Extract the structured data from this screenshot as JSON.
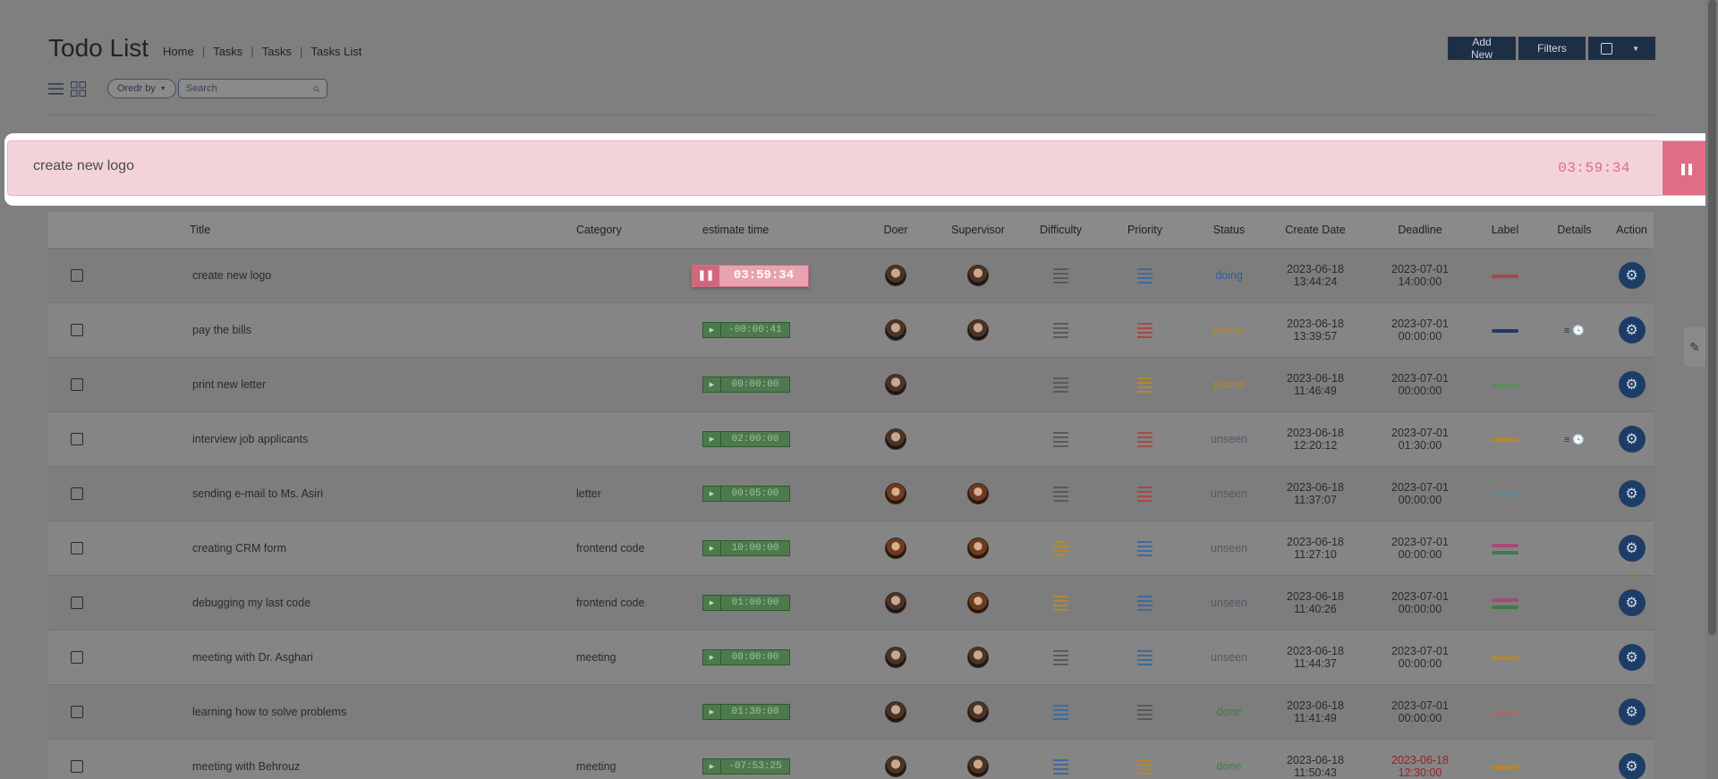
{
  "header": {
    "title": "Todo List",
    "breadcrumb": [
      "Home",
      "Tasks",
      "Tasks",
      "Tasks List"
    ],
    "add_new": "Add New",
    "filters": "Filters"
  },
  "toolbar": {
    "order_by": "Oredr by",
    "search_placeholder": "Search"
  },
  "active_timer": {
    "title": "create new logo",
    "time": "03:59:34"
  },
  "columns": [
    "Title",
    "Category",
    "estimate time",
    "Doer",
    "Supervisor",
    "Difficulty",
    "Priority",
    "Status",
    "Create Date",
    "Deadline",
    "Label",
    "Details",
    "Action"
  ],
  "colors": {
    "status_doing": "#2f5f9a",
    "status_pause": "#b8862a",
    "status_unseen": "#4f5966",
    "status_done": "#3f7a48",
    "deadline_overdue": "#9b1f1f",
    "lines_gray": "#5a5a5a",
    "lines_blue": "#3f6a9a",
    "lines_red": "#a84848",
    "lines_yellow": "#b08a30"
  },
  "rows": [
    {
      "title": "create new logo",
      "category": "",
      "est": "03:59:34",
      "active": true,
      "supervisor": true,
      "diff": "gray",
      "pri": "blue",
      "status": "doing",
      "status_color": "doing",
      "cdate": "2023-06-18",
      "ctime": "13:44:24",
      "ddate": "2023-07-01",
      "dtime": "14:00:00",
      "overdue": false,
      "labels": [
        "#a84848"
      ],
      "details": false
    },
    {
      "title": "pay the bills",
      "category": "",
      "est": "-00:00:41",
      "active": false,
      "supervisor": true,
      "diff": "gray",
      "pri": "red",
      "status": "pause",
      "status_color": "pause",
      "cdate": "2023-06-18",
      "ctime": "13:39:57",
      "ddate": "2023-07-01",
      "dtime": "00:00:00",
      "overdue": false,
      "labels": [
        "#1d3d66"
      ],
      "details": true
    },
    {
      "title": "print new letter",
      "category": "",
      "est": "00:00:00",
      "active": false,
      "supervisor": false,
      "diff": "gray",
      "pri": "yellow",
      "status": "pause",
      "status_color": "pause",
      "cdate": "2023-06-18",
      "ctime": "11:46:49",
      "ddate": "2023-07-01",
      "dtime": "00:00:00",
      "overdue": false,
      "labels": [
        "#5e8a5e"
      ],
      "details": false
    },
    {
      "title": "interview job applicants",
      "category": "",
      "est": "02:00:00",
      "active": false,
      "supervisor": false,
      "diff": "gray",
      "pri": "red",
      "status": "unseen",
      "status_color": "unseen",
      "cdate": "2023-06-18",
      "ctime": "12:20:12",
      "ddate": "2023-07-01",
      "dtime": "01:30:00",
      "overdue": false,
      "labels": [
        "#b8862a"
      ],
      "details": true
    },
    {
      "title": "sending e-mail to Ms. Asiri",
      "category": "letter",
      "est": "00:05:00",
      "active": false,
      "supervisor": true,
      "diff": "gray",
      "pri": "red",
      "status": "unseen",
      "status_color": "unseen",
      "cdate": "2023-06-18",
      "ctime": "11:37:07",
      "ddate": "2023-07-01",
      "dtime": "00:00:00",
      "overdue": false,
      "labels": [
        "#5a8a90"
      ],
      "details": false
    },
    {
      "title": "creating CRM form",
      "category": "frontend code",
      "est": "10:00:00",
      "active": false,
      "supervisor": true,
      "diff": "yellow",
      "pri": "blue",
      "status": "unseen",
      "status_color": "unseen",
      "cdate": "2023-06-18",
      "ctime": "11:27:10",
      "ddate": "2023-07-01",
      "dtime": "00:00:00",
      "overdue": false,
      "labels": [
        "#a84878",
        "#3f7a48"
      ],
      "details": false
    },
    {
      "title": "debugging my last code",
      "category": "frontend code",
      "est": "01:00:00",
      "active": false,
      "supervisor": true,
      "diff": "yellow",
      "pri": "blue",
      "status": "unseen",
      "status_color": "unseen",
      "cdate": "2023-06-18",
      "ctime": "11:40:26",
      "ddate": "2023-07-01",
      "dtime": "00:00:00",
      "overdue": false,
      "labels": [
        "#a84878",
        "#3f7a48"
      ],
      "details": false
    },
    {
      "title": "meeting with Dr. Asghari",
      "category": "meeting",
      "est": "00:00:00",
      "active": false,
      "supervisor": true,
      "diff": "gray",
      "pri": "blue",
      "status": "unseen",
      "status_color": "unseen",
      "cdate": "2023-06-18",
      "ctime": "11:44:37",
      "ddate": "2023-07-01",
      "dtime": "00:00:00",
      "overdue": false,
      "labels": [
        "#b8862a"
      ],
      "details": false
    },
    {
      "title": "learning how to solve problems",
      "category": "",
      "est": "01:30:00",
      "active": false,
      "supervisor": true,
      "diff": "blue",
      "pri": "gray",
      "status": "done",
      "status_color": "done",
      "cdate": "2023-06-18",
      "ctime": "11:41:49",
      "ddate": "2023-07-01",
      "dtime": "00:00:00",
      "overdue": false,
      "labels": [
        "#a86868"
      ],
      "details": false
    },
    {
      "title": "meeting with Behrouz",
      "category": "meeting",
      "est": "-07:53:25",
      "active": false,
      "supervisor": true,
      "diff": "blue",
      "pri": "yellow",
      "status": "done",
      "status_color": "done",
      "cdate": "2023-06-18",
      "ctime": "11:50:43",
      "ddate": "2023-06-18",
      "dtime": "12:30:00",
      "overdue": true,
      "labels": [
        "#b8862a"
      ],
      "details": false
    }
  ]
}
